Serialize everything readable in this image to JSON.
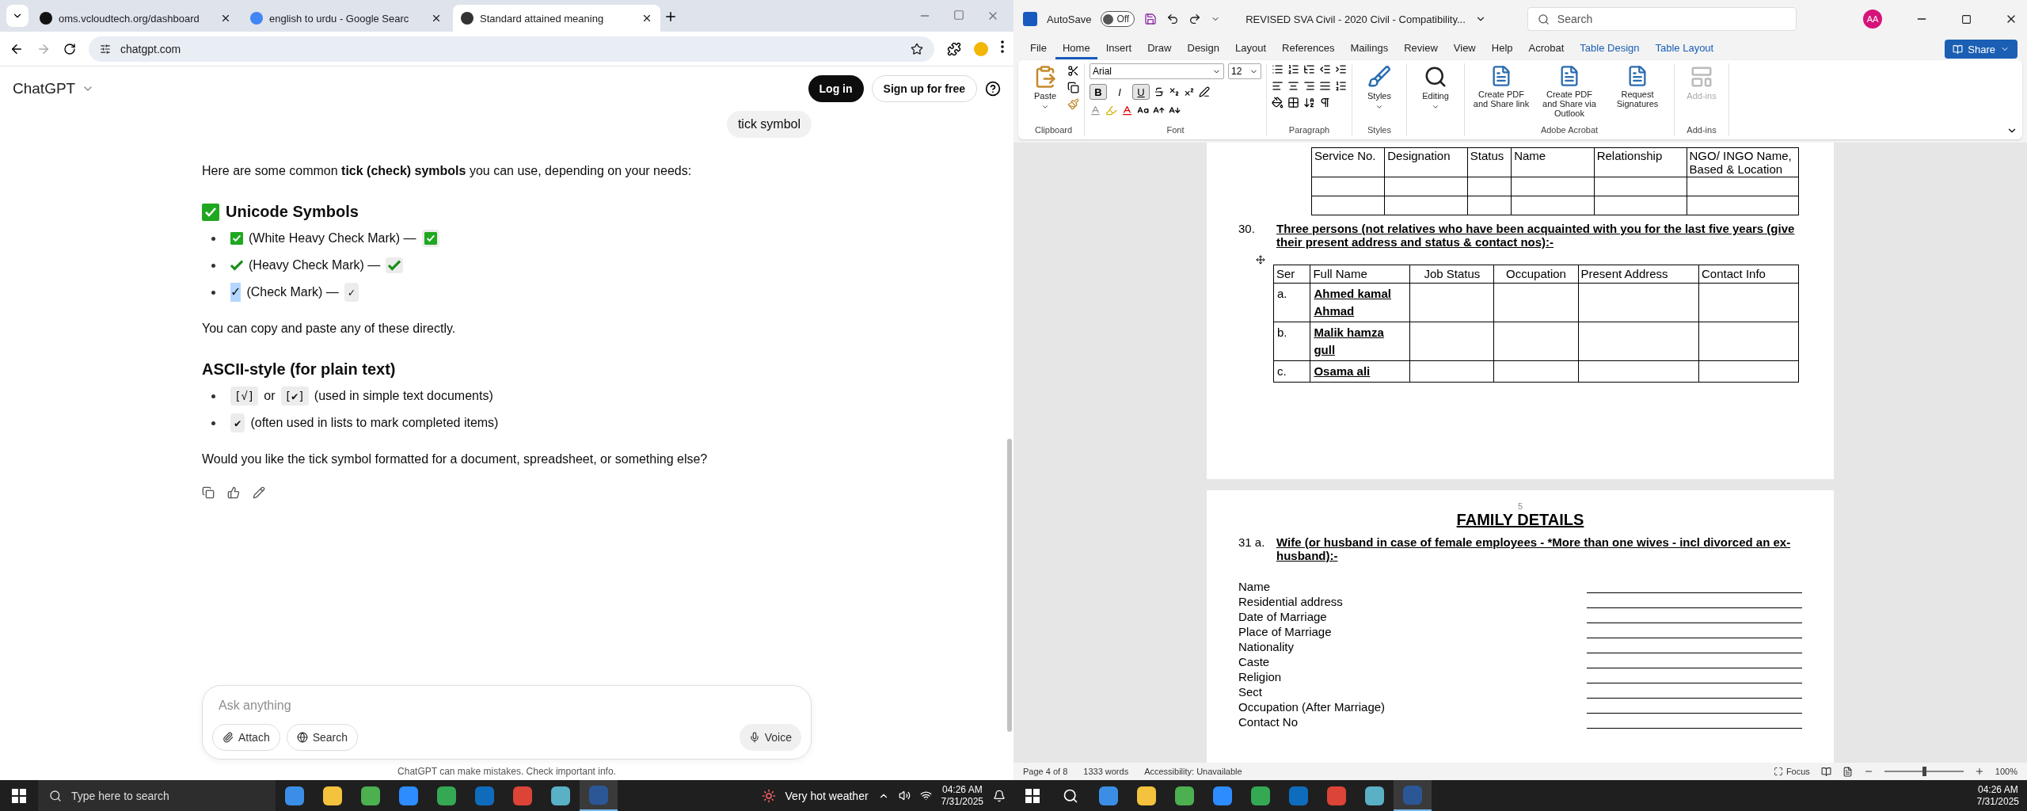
{
  "browser": {
    "tabs": [
      {
        "title": "oms.vcloudtech.org/dashboard",
        "selected": false
      },
      {
        "title": "english to urdu - Google Searc",
        "selected": false
      },
      {
        "title": "Standard attained meaning",
        "selected": true
      }
    ],
    "address": "chatgpt.com"
  },
  "chat": {
    "model": "ChatGPT",
    "login": "Log in",
    "signup": "Sign up for free",
    "user_message": "tick symbol",
    "intro": "Here are some common **tick (check) symbols** you can use, depending on your needs:",
    "section_1": {
      "title": "Unicode Symbols",
      "items": [
        {
          "kind": "box",
          "label": "(White Heavy Check Mark) —",
          "highlighted": false
        },
        {
          "kind": "heavy",
          "label": "(Heavy Check Mark) —",
          "highlighted": false
        },
        {
          "kind": "plain",
          "symbol": "✓",
          "label": "(Check Mark) —",
          "copy": "✓",
          "highlighted": true
        }
      ]
    },
    "note": "You can copy and paste any of these directly.",
    "section_2": {
      "title": "ASCII-style (for plain text)",
      "items": [
        {
          "parts": [
            {
              "kind": "code",
              "text": "[√]"
            },
            {
              "kind": "text",
              "text": "or"
            },
            {
              "kind": "code",
              "text": "[✔]"
            },
            {
              "kind": "text",
              "text": "(used in simple text documents)"
            }
          ]
        },
        {
          "parts": [
            {
              "kind": "code",
              "text": "✔"
            },
            {
              "kind": "text",
              "text": "(often used in lists to mark completed items)"
            }
          ]
        }
      ]
    },
    "question": "Would you like the tick symbol formatted for a document, spreadsheet, or something else?",
    "composer": {
      "placeholder": "Ask anything",
      "attach": "Attach",
      "search": "Search",
      "voice": "Voice"
    },
    "disclaimer": "ChatGPT can make mistakes. Check important info."
  },
  "taskbar_left": {
    "search_placeholder": "Type here to search",
    "weather": "Very hot weather",
    "time": "04:26 AM",
    "date": "7/31/2025"
  },
  "word": {
    "autosave": {
      "label": "AutoSave",
      "on": false,
      "state": "Off"
    },
    "title": "REVISED SVA Civil - 2020 Civil  -  Compatibility...",
    "search": "Search",
    "avatar": "AA",
    "menu": [
      {
        "label": "File",
        "selected": false,
        "kind": "plain"
      },
      {
        "label": "Home",
        "selected": true,
        "kind": "plain"
      },
      {
        "label": "Insert",
        "selected": false,
        "kind": "plain"
      },
      {
        "label": "Draw",
        "selected": false,
        "kind": "plain"
      },
      {
        "label": "Design",
        "selected": false,
        "kind": "plain"
      },
      {
        "label": "Layout",
        "selected": false,
        "kind": "plain"
      },
      {
        "label": "References",
        "selected": false,
        "kind": "plain"
      },
      {
        "label": "Mailings",
        "selected": false,
        "kind": "plain"
      },
      {
        "label": "Review",
        "selected": false,
        "kind": "plain"
      },
      {
        "label": "View",
        "selected": false,
        "kind": "plain"
      },
      {
        "label": "Help",
        "selected": false,
        "kind": "plain"
      },
      {
        "label": "Acrobat",
        "selected": false,
        "kind": "plain"
      },
      {
        "label": "Table Design",
        "selected": false,
        "kind": "contextual"
      },
      {
        "label": "Table Layout",
        "selected": false,
        "kind": "contextual"
      }
    ],
    "share": "Share",
    "ribbon": {
      "paste": "Paste",
      "font": "Arial",
      "size": "12",
      "format": [
        {
          "label": "B",
          "selected": true
        },
        {
          "label": "I",
          "selected": false
        },
        {
          "label": "U",
          "selected": true
        }
      ],
      "styles": "Styles",
      "editing": "Editing",
      "acrobat": [
        "Create PDF and Share link",
        "Create PDF and Share via Outlook",
        "Request Signatures"
      ],
      "addins": {
        "label": "Add-ins",
        "disabled": true
      },
      "groups": [
        "Clipboard",
        "Font",
        "Paragraph",
        "Styles",
        "Adobe Acrobat",
        "Add-ins"
      ]
    },
    "document": {
      "table_1": {
        "columns": [
          "Service No.",
          "Designation",
          "Status",
          "Name",
          "Relationship",
          "NGO/ INGO Name, Based & Location"
        ]
      },
      "section_30": {
        "number": "30.",
        "heading": "Three persons (not relatives who have been acquainted with you for the last five years (give their present address and status & contact nos):-"
      },
      "table_2": {
        "columns": [
          "Ser",
          "Full Name",
          "Job Status",
          "Occupation",
          "Present Address",
          "Contact Info"
        ],
        "rows": [
          {
            "ser": "a.",
            "name": "Ahmed kamal Ahmad"
          },
          {
            "ser": "b.",
            "name": "Malik hamza gull"
          },
          {
            "ser": "c.",
            "name": "Osama ali"
          }
        ]
      },
      "page_number": "5",
      "title": "FAMILY DETAILS",
      "section_31": {
        "number": "31 a.",
        "heading": "Wife (or husband in case of female employees - *More than one wives - incl divorced an ex-husband):-"
      },
      "fields": [
        "Name",
        "Residential address",
        "Date of Marriage",
        "Place of Marriage",
        "Nationality",
        "Caste",
        "Religion",
        "Sect",
        "Occupation (After Marriage)",
        "Contact No"
      ]
    },
    "status": {
      "page": "Page 4 of 8",
      "words": "1333 words",
      "accessibility": "Accessibility: Unavailable",
      "focus": "Focus",
      "zoom": "100%",
      "zoom_slider": {
        "level": 0.5
      }
    }
  },
  "taskbar_right": {
    "time": "04:26 AM",
    "date": "7/31/2025"
  }
}
